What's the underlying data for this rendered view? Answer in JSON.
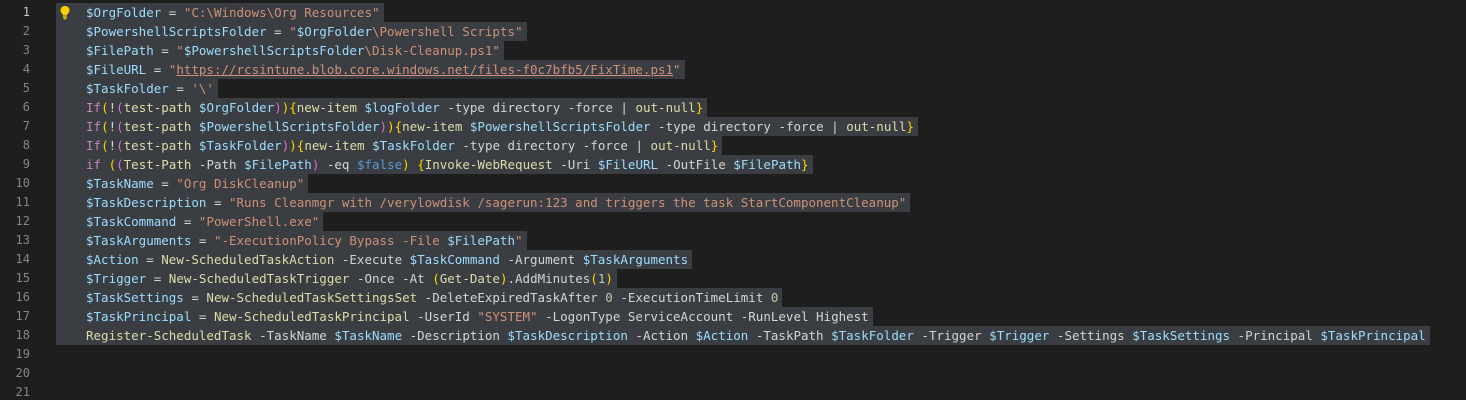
{
  "editor": {
    "active_line": 1,
    "line_numbers": [
      "1",
      "2",
      "3",
      "4",
      "5",
      "6",
      "7",
      "8",
      "9",
      "10",
      "11",
      "12",
      "13",
      "14",
      "15",
      "16",
      "17",
      "18",
      "19",
      "20",
      "21"
    ],
    "code_lines": [
      [
        [
          "var",
          "$OrgFolder"
        ],
        [
          "op",
          " = "
        ],
        [
          "str",
          "\"C:\\Windows\\Org Resources\""
        ]
      ],
      [
        [
          "var",
          "$PowershellScriptsFolder"
        ],
        [
          "op",
          " = "
        ],
        [
          "str",
          "\""
        ],
        [
          "var",
          "$OrgFolder"
        ],
        [
          "str",
          "\\Powershell Scripts\""
        ]
      ],
      [
        [
          "var",
          "$FilePath"
        ],
        [
          "op",
          " = "
        ],
        [
          "str",
          "\""
        ],
        [
          "var",
          "$PowershellScriptsFolder"
        ],
        [
          "str",
          "\\Disk-Cleanup.ps1\""
        ]
      ],
      [
        [
          "var",
          "$FileURL"
        ],
        [
          "op",
          " = "
        ],
        [
          "str",
          "\""
        ],
        [
          "url",
          "https://rcsintune.blob.core.windows.net/files-f0c7bfb5/FixTime.ps1"
        ],
        [
          "str",
          "\""
        ]
      ],
      [
        [
          "var",
          "$TaskFolder"
        ],
        [
          "op",
          " = "
        ],
        [
          "str",
          "'\\'"
        ]
      ],
      [
        [
          "kw",
          "If"
        ],
        [
          "p1",
          "("
        ],
        [
          "op",
          "!"
        ],
        [
          "p2",
          "("
        ],
        [
          "cmd",
          "test-path"
        ],
        [
          "op",
          " "
        ],
        [
          "var",
          "$OrgFolder"
        ],
        [
          "p2",
          ")"
        ],
        [
          "p1",
          ")"
        ],
        [
          "p1",
          "{"
        ],
        [
          "cmd",
          "new-item"
        ],
        [
          "op",
          " "
        ],
        [
          "var",
          "$logFolder"
        ],
        [
          "param",
          " -type "
        ],
        [
          "op",
          "directory"
        ],
        [
          "param",
          " -force"
        ],
        [
          "op",
          " | "
        ],
        [
          "cmd",
          "out-null"
        ],
        [
          "p1",
          "}"
        ]
      ],
      [
        [
          "kw",
          "If"
        ],
        [
          "p1",
          "("
        ],
        [
          "op",
          "!"
        ],
        [
          "p2",
          "("
        ],
        [
          "cmd",
          "test-path"
        ],
        [
          "op",
          " "
        ],
        [
          "var",
          "$PowershellScriptsFolder"
        ],
        [
          "p2",
          ")"
        ],
        [
          "p1",
          ")"
        ],
        [
          "p1",
          "{"
        ],
        [
          "cmd",
          "new-item"
        ],
        [
          "op",
          " "
        ],
        [
          "var",
          "$PowershellScriptsFolder"
        ],
        [
          "param",
          " -type "
        ],
        [
          "op",
          "directory"
        ],
        [
          "param",
          " -force"
        ],
        [
          "op",
          " | "
        ],
        [
          "cmd",
          "out-null"
        ],
        [
          "p1",
          "}"
        ]
      ],
      [
        [
          "kw",
          "If"
        ],
        [
          "p1",
          "("
        ],
        [
          "op",
          "!"
        ],
        [
          "p2",
          "("
        ],
        [
          "cmd",
          "test-path"
        ],
        [
          "op",
          " "
        ],
        [
          "var",
          "$TaskFolder"
        ],
        [
          "p2",
          ")"
        ],
        [
          "p1",
          ")"
        ],
        [
          "p1",
          "{"
        ],
        [
          "cmd",
          "new-item"
        ],
        [
          "op",
          " "
        ],
        [
          "var",
          "$TaskFolder"
        ],
        [
          "param",
          " -type "
        ],
        [
          "op",
          "directory"
        ],
        [
          "param",
          " -force"
        ],
        [
          "op",
          " | "
        ],
        [
          "cmd",
          "out-null"
        ],
        [
          "p1",
          "}"
        ]
      ],
      [
        [
          "kw",
          "if"
        ],
        [
          "op",
          " "
        ],
        [
          "p1",
          "("
        ],
        [
          "p2",
          "("
        ],
        [
          "cmd",
          "Test-Path"
        ],
        [
          "param",
          " -Path "
        ],
        [
          "var",
          "$FilePath"
        ],
        [
          "p2",
          ")"
        ],
        [
          "param",
          " -eq "
        ],
        [
          "bool",
          "$false"
        ],
        [
          "p1",
          ")"
        ],
        [
          "op",
          " "
        ],
        [
          "p1",
          "{"
        ],
        [
          "cmd",
          "Invoke-WebRequest"
        ],
        [
          "param",
          " -Uri "
        ],
        [
          "var",
          "$FileURL"
        ],
        [
          "param",
          " -OutFile "
        ],
        [
          "var",
          "$FilePath"
        ],
        [
          "p1",
          "}"
        ]
      ],
      [
        [
          "var",
          "$TaskName"
        ],
        [
          "op",
          " = "
        ],
        [
          "str",
          "\"Org DiskCleanup\""
        ]
      ],
      [
        [
          "var",
          "$TaskDescription"
        ],
        [
          "op",
          " = "
        ],
        [
          "str",
          "\"Runs Cleanmgr with /verylowdisk /sagerun:123 and triggers the task StartComponentCleanup\""
        ]
      ],
      [
        [
          "var",
          "$TaskCommand"
        ],
        [
          "op",
          " = "
        ],
        [
          "str",
          "\"PowerShell.exe\""
        ]
      ],
      [
        [
          "var",
          "$TaskArguments"
        ],
        [
          "op",
          " = "
        ],
        [
          "str",
          "\"-ExecutionPolicy Bypass -File "
        ],
        [
          "var",
          "$FilePath"
        ],
        [
          "str",
          "\""
        ]
      ],
      [
        [
          "var",
          "$Action"
        ],
        [
          "op",
          " = "
        ],
        [
          "cmd",
          "New-ScheduledTaskAction"
        ],
        [
          "param",
          " -Execute "
        ],
        [
          "var",
          "$TaskCommand"
        ],
        [
          "param",
          " -Argument "
        ],
        [
          "var",
          "$TaskArguments"
        ]
      ],
      [
        [
          "var",
          "$Trigger"
        ],
        [
          "op",
          " = "
        ],
        [
          "cmd",
          "New-ScheduledTaskTrigger"
        ],
        [
          "param",
          " -Once -At "
        ],
        [
          "p1",
          "("
        ],
        [
          "cmd",
          "Get-Date"
        ],
        [
          "p1",
          ")"
        ],
        [
          "op",
          ".AddMinutes"
        ],
        [
          "p1",
          "("
        ],
        [
          "num",
          "1"
        ],
        [
          "p1",
          ")"
        ]
      ],
      [
        [
          "var",
          "$TaskSettings"
        ],
        [
          "op",
          " = "
        ],
        [
          "cmd",
          "New-ScheduledTaskSettingsSet"
        ],
        [
          "param",
          " -DeleteExpiredTaskAfter "
        ],
        [
          "num",
          "0"
        ],
        [
          "param",
          " -ExecutionTimeLimit "
        ],
        [
          "num",
          "0"
        ]
      ],
      [
        [
          "var",
          "$TaskPrincipal"
        ],
        [
          "op",
          " = "
        ],
        [
          "cmd",
          "New-ScheduledTaskPrincipal"
        ],
        [
          "param",
          " -UserId "
        ],
        [
          "str",
          "\"SYSTEM\""
        ],
        [
          "param",
          " -LogonType "
        ],
        [
          "op",
          "ServiceAccount"
        ],
        [
          "param",
          " -RunLevel "
        ],
        [
          "op",
          "Highest"
        ]
      ],
      [
        [
          "cmd",
          "Register-ScheduledTask"
        ],
        [
          "param",
          " -TaskName "
        ],
        [
          "var",
          "$TaskName"
        ],
        [
          "param",
          " -Description "
        ],
        [
          "var",
          "$TaskDescription"
        ],
        [
          "param",
          " -Action "
        ],
        [
          "var",
          "$Action"
        ],
        [
          "param",
          " -TaskPath "
        ],
        [
          "var",
          "$TaskFolder"
        ],
        [
          "param",
          " -Trigger "
        ],
        [
          "var",
          "$Trigger"
        ],
        [
          "param",
          " -Settings "
        ],
        [
          "var",
          "$TaskSettings"
        ],
        [
          "param",
          " -Principal "
        ],
        [
          "var",
          "$TaskPrincipal"
        ]
      ],
      [],
      [],
      []
    ]
  },
  "icons": {
    "lightbulb": "lightbulb-icon"
  },
  "colors": {
    "background": "#1e1e1e",
    "selection": "#3a3d41",
    "line_number": "#858585",
    "variable": "#9cdcfe",
    "string": "#ce9178",
    "command": "#dcdcaa",
    "keyword": "#c586c0",
    "number": "#b5cea8",
    "boolean": "#569cd6",
    "bracket_1": "#ffd700",
    "bracket_2": "#da70d6",
    "lightbulb": "#ffcc00"
  }
}
